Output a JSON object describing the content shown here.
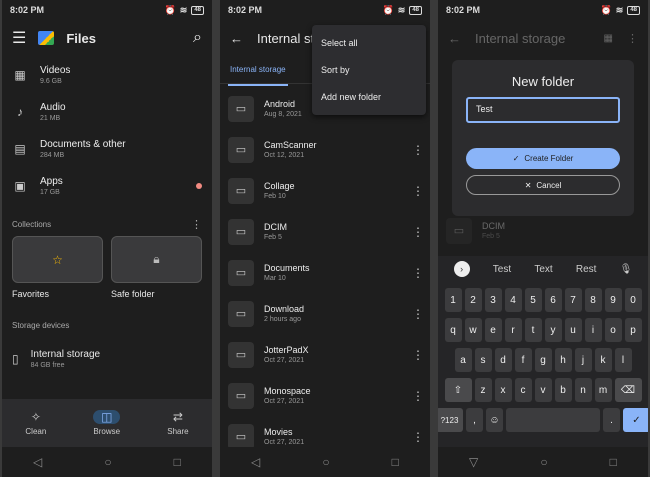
{
  "status": {
    "time": "8:02 PM",
    "battery": "48"
  },
  "screen1": {
    "title": "Files",
    "categories": [
      {
        "name": "Videos",
        "sub": "9.6 GB",
        "icon": "video-icon"
      },
      {
        "name": "Audio",
        "sub": "21 MB",
        "icon": "music-icon"
      },
      {
        "name": "Documents & other",
        "sub": "284 MB",
        "icon": "document-icon"
      },
      {
        "name": "Apps",
        "sub": "17 GB",
        "icon": "apps-icon"
      }
    ],
    "collections_label": "Collections",
    "favorites_label": "Favorites",
    "safe_folder_label": "Safe folder",
    "storage_devices_label": "Storage devices",
    "internal_storage": {
      "name": "Internal storage",
      "sub": "84 GB free"
    },
    "bottom_nav": [
      {
        "label": "Clean",
        "icon": "clean-icon"
      },
      {
        "label": "Browse",
        "icon": "browse-icon",
        "active": true
      },
      {
        "label": "Share",
        "icon": "share-icon"
      }
    ]
  },
  "screen2": {
    "title": "Internal sto",
    "crumb": "Internal storage",
    "menu": [
      "Select all",
      "Sort by",
      "Add new folder"
    ],
    "folders": [
      {
        "name": "Android",
        "date": "Aug 8, 2021"
      },
      {
        "name": "CamScanner",
        "date": "Oct 12, 2021"
      },
      {
        "name": "Collage",
        "date": "Feb 10"
      },
      {
        "name": "DCIM",
        "date": "Feb 5"
      },
      {
        "name": "Documents",
        "date": "Mar 10"
      },
      {
        "name": "Download",
        "date": "2 hours ago"
      },
      {
        "name": "JotterPadX",
        "date": "Oct 27, 2021"
      },
      {
        "name": "Monospace",
        "date": "Oct 27, 2021"
      },
      {
        "name": "Movies",
        "date": "Oct 27, 2021"
      }
    ]
  },
  "screen3": {
    "title": "Internal storage",
    "dialog_title": "New folder",
    "input_value": "Test",
    "create_label": "Create Folder",
    "cancel_label": "Cancel",
    "bg_folder": {
      "name": "DCIM",
      "date": "Feb 5"
    },
    "suggestions": [
      "Test",
      "Text",
      "Rest"
    ],
    "keys_row1": [
      "1",
      "2",
      "3",
      "4",
      "5",
      "6",
      "7",
      "8",
      "9",
      "0"
    ],
    "keys_row2": [
      "q",
      "w",
      "e",
      "r",
      "t",
      "y",
      "u",
      "i",
      "o",
      "p"
    ],
    "keys_row3": [
      "a",
      "s",
      "d",
      "f",
      "g",
      "h",
      "j",
      "k",
      "l"
    ],
    "keys_row4": [
      "z",
      "x",
      "c",
      "v",
      "b",
      "n",
      "m"
    ],
    "sym_key": "?123",
    "comma_key": ",",
    "period_key": "."
  }
}
